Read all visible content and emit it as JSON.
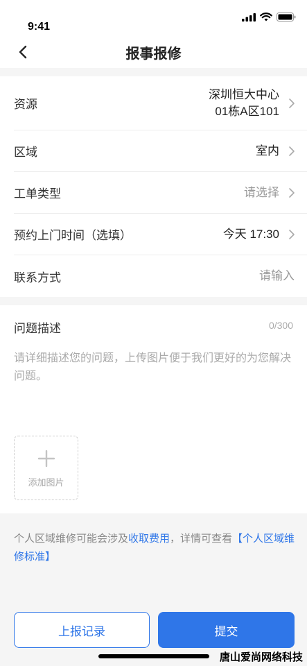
{
  "status_bar": {
    "time": "9:41"
  },
  "header": {
    "title": "报事报修"
  },
  "form": {
    "resource": {
      "label": "资源",
      "value_line1": "深圳恒大中心",
      "value_line2": "01栋A区101"
    },
    "area": {
      "label": "区域",
      "value": "室内"
    },
    "order_type": {
      "label": "工单类型",
      "placeholder": "请选择"
    },
    "appointment": {
      "label": "预约上门时间（选填）",
      "value": "今天 17:30"
    },
    "contact": {
      "label": "联系方式",
      "placeholder": "请输入"
    }
  },
  "description": {
    "label": "问题描述",
    "counter": "0/300",
    "placeholder": "请详细描述您的问题，上传图片便于我们更好的为您解决问题。",
    "upload_label": "添加图片"
  },
  "notice": {
    "text_before": "个人区域维修可能会涉及",
    "link_fee": "收取费用",
    "text_middle": "，详情可查看",
    "link_standard": "【个人区域维修标准】"
  },
  "buttons": {
    "history": "上报记录",
    "submit": "提交"
  },
  "watermark": "唐山爱尚网络科技",
  "colors": {
    "accent": "#2f76e8",
    "placeholder": "#999999"
  }
}
